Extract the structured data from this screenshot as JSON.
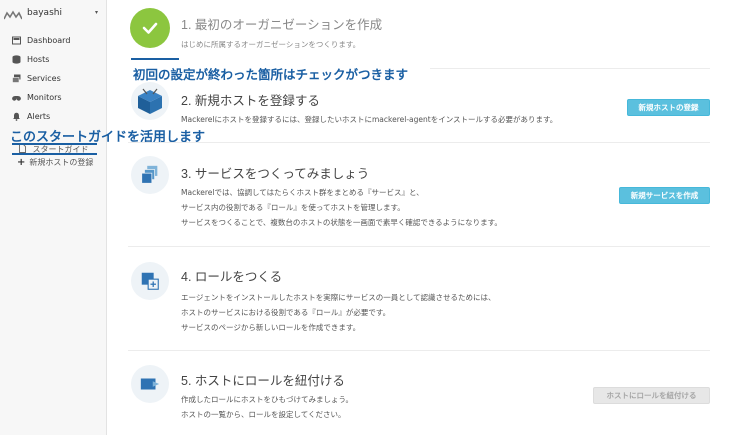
{
  "sidebar": {
    "org_name": "bayashi",
    "caret": "▾",
    "nav": [
      {
        "label": "Dashboard",
        "icon": "dashboard-icon"
      },
      {
        "label": "Hosts",
        "icon": "hosts-icon"
      },
      {
        "label": "Services",
        "icon": "services-icon"
      },
      {
        "label": "Monitors",
        "icon": "monitors-icon"
      },
      {
        "label": "Alerts",
        "icon": "bell-icon"
      }
    ],
    "guide_label": "スタートガイド",
    "register_host_label": "新規ホストの登録",
    "plus": "+"
  },
  "annotations": {
    "check_note": "初回の設定が終わった箇所はチェックがつきます",
    "guide_note": "このスタートガイドを活用します"
  },
  "steps": [
    {
      "title": "1. 最初のオーガニゼーションを作成",
      "desc": [
        "はじめに所属するオーガニゼーションをつくります。"
      ],
      "icon": "check-icon",
      "completed": true
    },
    {
      "title": "2. 新規ホストを登録する",
      "desc": [
        "Mackerelにホストを登録するには、登録したいホストにmackerel-agentをインストールする必要があります。"
      ],
      "icon": "host-box-icon",
      "button": "新規ホストの登録",
      "button_enabled": true
    },
    {
      "title": "3. サービスをつくってみましょう",
      "desc": [
        "Mackerelでは、協調してはたらくホスト群をまとめる『サービス』と、",
        "サービス内の役割である『ロール』を使ってホストを管理します。",
        "サービスをつくることで、複数台のホストの状態を一画面で素早く確認できるようになります。"
      ],
      "icon": "service-stack-icon",
      "button": "新規サービスを作成",
      "button_enabled": true
    },
    {
      "title": "4. ロールをつくる",
      "desc": [
        "エージェントをインストールしたホストを実際にサービスの一員として認識させるためには、",
        "ホストのサービスにおける役割である『ロール』が必要です。",
        "サービスのページから新しいロールを作成できます。"
      ],
      "icon": "role-add-icon"
    },
    {
      "title": "5. ホストにロールを紐付ける",
      "desc": [
        "作成したロールにホストをひもづけてみましょう。",
        "ホストの一覧から、ロールを設定してください。"
      ],
      "icon": "host-role-link-icon",
      "button": "ホストにロールを紐付ける",
      "button_enabled": false
    }
  ],
  "colors": {
    "accent": "#5bc0de",
    "check": "#8cc63f",
    "annotation": "#1a5fa3"
  }
}
